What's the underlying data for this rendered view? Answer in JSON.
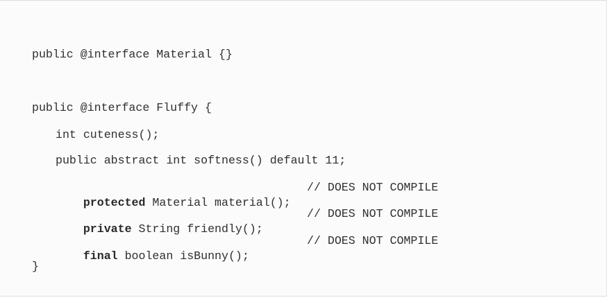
{
  "code": {
    "line1": "public @interface Material {}",
    "line2": "public @interface Fluffy {",
    "line3": "int cuteness();",
    "line4": "public abstract int softness() default 11;",
    "line5": {
      "keyword": "protected",
      "rest": " Material material();",
      "comment": "// DOES NOT COMPILE"
    },
    "line6": {
      "keyword": "private",
      "rest": " String friendly();",
      "comment": "// DOES NOT COMPILE"
    },
    "line7": {
      "keyword": "final",
      "rest": " boolean isBunny();",
      "comment": "// DOES NOT COMPILE"
    },
    "line8": "}"
  }
}
